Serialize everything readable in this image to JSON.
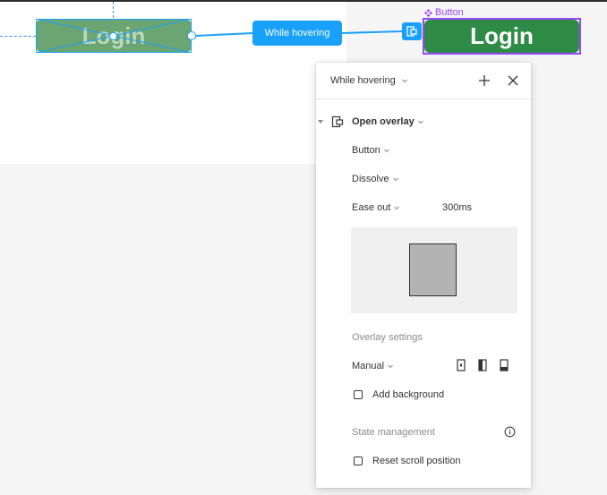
{
  "canvas": {
    "source_button_label": "Login",
    "trigger_label": "While hovering",
    "component_label": "Button",
    "destination_button_label": "Login",
    "colors": {
      "selection_blue": "#18a0fb",
      "component_purple": "#9747ff",
      "button_green": "#2e8b45"
    }
  },
  "panel": {
    "trigger": "While hovering",
    "action": "Open overlay",
    "destination": "Button",
    "animation": "Dissolve",
    "easing": "Ease out",
    "duration": "300ms",
    "overlay_settings_title": "Overlay settings",
    "position": "Manual",
    "add_background_label": "Add background",
    "state_management_title": "State management",
    "reset_scroll_label": "Reset scroll position",
    "icons": [
      "plus-icon",
      "close-icon",
      "open-overlay-icon",
      "info-icon",
      "position-center-icon",
      "position-left-icon",
      "position-bottom-icon"
    ]
  }
}
